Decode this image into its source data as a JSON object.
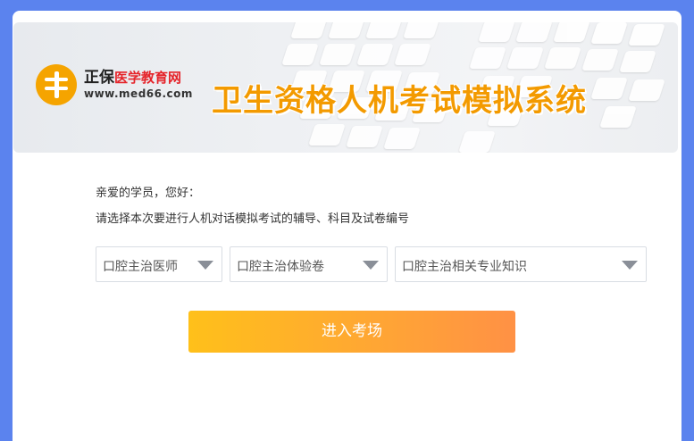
{
  "banner": {
    "logo_brand": "正保",
    "logo_brand_sub": "医学教育网",
    "logo_url": "www.med66.com",
    "system_title": "卫生资格人机考试模拟系统"
  },
  "intro": {
    "greeting": "亲爱的学员，您好：",
    "instruction": "请选择本次要进行人机对话模拟考试的辅导、科目及试卷编号"
  },
  "selects": {
    "coaching": {
      "value": "口腔主治医师"
    },
    "subject": {
      "value": "口腔主治体验卷"
    },
    "paper": {
      "value": "口腔主治相关专业知识"
    }
  },
  "actions": {
    "enter_label": "进入考场"
  },
  "colors": {
    "page_background": "#5b83ee",
    "title_orange": "#f39a00",
    "logo_orange": "#f5a400",
    "button_start": "#ffc01a",
    "button_end": "#ff9145"
  },
  "icons": {
    "logo": "med66-logo-icon",
    "dropdown": "caret-down-icon"
  }
}
